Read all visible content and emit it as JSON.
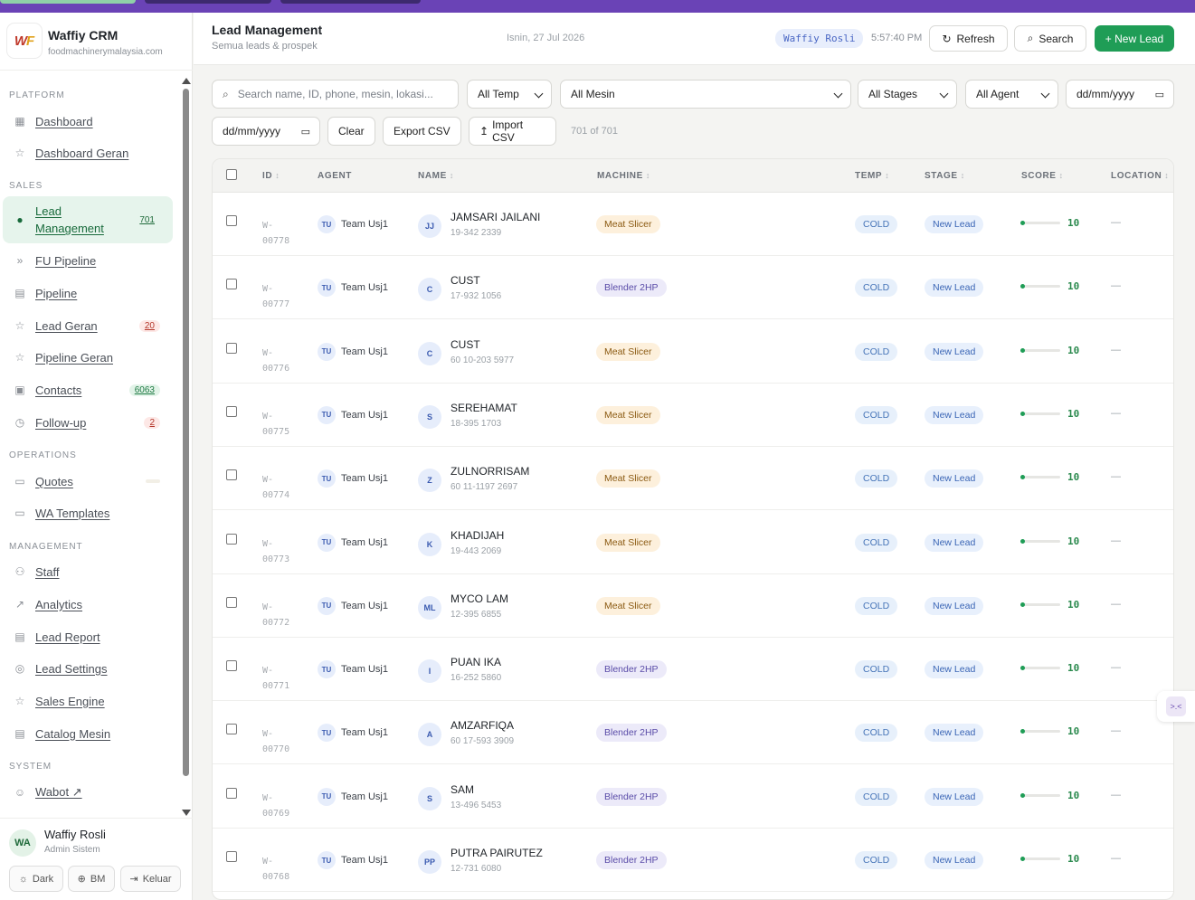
{
  "colors": {
    "accent": "#1f9d56",
    "top_strip": "#6a43b6",
    "active_nav_bg": "#e6f4ec"
  },
  "brand": {
    "logo_text_w": "W",
    "logo_text_f": "F",
    "title": "Waffiy CRM",
    "subtitle": "foodmachinerymalaysia.com"
  },
  "sidebar": {
    "sections": [
      {
        "label": "PLATFORM",
        "items": [
          {
            "label": "Dashboard",
            "icon": "grid-icon",
            "badge": ""
          },
          {
            "label": "Dashboard Geran",
            "icon": "star-icon",
            "badge": ""
          }
        ]
      },
      {
        "label": "SALES",
        "items": [
          {
            "label": "Lead Management",
            "icon": "person-icon",
            "badge": "701",
            "active": true
          },
          {
            "label": "FU Pipeline",
            "icon": "chevrons-icon",
            "badge": ""
          },
          {
            "label": "Pipeline",
            "icon": "table-icon",
            "badge": ""
          },
          {
            "label": "Lead Geran",
            "icon": "star-icon",
            "badge": "20"
          },
          {
            "label": "Pipeline Geran",
            "icon": "star-icon",
            "badge": ""
          },
          {
            "label": "Contacts",
            "icon": "contact-icon",
            "badge": "6063"
          },
          {
            "label": "Follow-up",
            "icon": "clock-icon",
            "badge": "2"
          }
        ]
      },
      {
        "label": "OPERATIONS",
        "items": [
          {
            "label": "Quotes",
            "icon": "doc-icon",
            "badge": ""
          },
          {
            "label": "WA Templates",
            "icon": "doc-icon",
            "badge": ""
          }
        ]
      },
      {
        "label": "MANAGEMENT",
        "items": [
          {
            "label": "Staff",
            "icon": "users-icon",
            "badge": ""
          },
          {
            "label": "Analytics",
            "icon": "trend-icon",
            "badge": ""
          },
          {
            "label": "Lead Report",
            "icon": "report-icon",
            "badge": ""
          },
          {
            "label": "Lead Settings",
            "icon": "settings-icon",
            "badge": ""
          },
          {
            "label": "Sales Engine",
            "icon": "star-icon",
            "badge": ""
          },
          {
            "label": "Catalog Mesin",
            "icon": "table-icon",
            "badge": ""
          }
        ]
      },
      {
        "label": "SYSTEM",
        "items": [
          {
            "label": "Wabot ↗",
            "icon": "bot-icon",
            "badge": ""
          }
        ]
      }
    ]
  },
  "user": {
    "initials": "WA",
    "name": "Waffiy Rosli",
    "role": "Admin Sistem",
    "dark_label": "Dark",
    "lang_label": "BM",
    "logout_label": "Keluar"
  },
  "header": {
    "title": "Lead Management",
    "subtitle": "Semua leads & prospek",
    "date": "Isnin, 27 Jul 2026",
    "user_chip": "Waffiy Rosli",
    "time": "5:57:40 PM",
    "refresh_label": "Refresh",
    "search_label": "Search",
    "new_lead_label": "+ New Lead"
  },
  "filters": {
    "search_placeholder": "Search name, ID, phone, mesin, lokasi...",
    "temp": "All Temp",
    "mesin": "All Mesin",
    "stages": "All Stages",
    "agent": "All Agent",
    "date_from": "dd/mm/yyyy",
    "date_to": "dd/mm/yyyy",
    "clear_label": "Clear",
    "export_label": "Export CSV",
    "import_label": "Import CSV",
    "count": "701 of 701"
  },
  "table": {
    "headers": {
      "id": "ID",
      "agent": "AGENT",
      "name": "NAME",
      "machine": "MACHINE",
      "temp": "TEMP",
      "stage": "STAGE",
      "score": "SCORE",
      "location": "LOCATION"
    },
    "rows": [
      {
        "id1": "W-",
        "id2": "00778",
        "agent_initials": "TU",
        "agent": "Team Usj1",
        "name_initials": "JJ",
        "name": "JAMSARI JAILANI",
        "phone": "19-342 2339",
        "machine": "Meat Slicer",
        "machine_type": "slicer",
        "temp": "COLD",
        "stage": "New Lead",
        "score": "10",
        "location": "—"
      },
      {
        "id1": "W-",
        "id2": "00777",
        "agent_initials": "TU",
        "agent": "Team Usj1",
        "name_initials": "C",
        "name": "CUST",
        "phone": "17-932 1056",
        "machine": "Blender 2HP",
        "machine_type": "blender",
        "temp": "COLD",
        "stage": "New Lead",
        "score": "10",
        "location": "—"
      },
      {
        "id1": "W-",
        "id2": "00776",
        "agent_initials": "TU",
        "agent": "Team Usj1",
        "name_initials": "C",
        "name": "CUST",
        "phone": "60 10-203 5977",
        "machine": "Meat Slicer",
        "machine_type": "slicer",
        "temp": "COLD",
        "stage": "New Lead",
        "score": "10",
        "location": "—"
      },
      {
        "id1": "W-",
        "id2": "00775",
        "agent_initials": "TU",
        "agent": "Team Usj1",
        "name_initials": "S",
        "name": "SEREHAMAT",
        "phone": "18-395 1703",
        "machine": "Meat Slicer",
        "machine_type": "slicer",
        "temp": "COLD",
        "stage": "New Lead",
        "score": "10",
        "location": "—"
      },
      {
        "id1": "W-",
        "id2": "00774",
        "agent_initials": "TU",
        "agent": "Team Usj1",
        "name_initials": "Z",
        "name": "ZULNORRISAM",
        "phone": "60 11-1197 2697",
        "machine": "Meat Slicer",
        "machine_type": "slicer",
        "temp": "COLD",
        "stage": "New Lead",
        "score": "10",
        "location": "—"
      },
      {
        "id1": "W-",
        "id2": "00773",
        "agent_initials": "TU",
        "agent": "Team Usj1",
        "name_initials": "K",
        "name": "KHADIJAH",
        "phone": "19-443 2069",
        "machine": "Meat Slicer",
        "machine_type": "slicer",
        "temp": "COLD",
        "stage": "New Lead",
        "score": "10",
        "location": "—"
      },
      {
        "id1": "W-",
        "id2": "00772",
        "agent_initials": "TU",
        "agent": "Team Usj1",
        "name_initials": "ML",
        "name": "MYCO LAM",
        "phone": "12-395 6855",
        "machine": "Meat Slicer",
        "machine_type": "slicer",
        "temp": "COLD",
        "stage": "New Lead",
        "score": "10",
        "location": "—"
      },
      {
        "id1": "W-",
        "id2": "00771",
        "agent_initials": "TU",
        "agent": "Team Usj1",
        "name_initials": "I",
        "name": "PUAN IKA",
        "phone": "16-252 5860",
        "machine": "Blender 2HP",
        "machine_type": "blender",
        "temp": "COLD",
        "stage": "New Lead",
        "score": "10",
        "location": "—"
      },
      {
        "id1": "W-",
        "id2": "00770",
        "agent_initials": "TU",
        "agent": "Team Usj1",
        "name_initials": "A",
        "name": "AMZARFIQA",
        "phone": "60 17-593 3909",
        "machine": "Blender 2HP",
        "machine_type": "blender",
        "temp": "COLD",
        "stage": "New Lead",
        "score": "10",
        "location": "—"
      },
      {
        "id1": "W-",
        "id2": "00769",
        "agent_initials": "TU",
        "agent": "Team Usj1",
        "name_initials": "S",
        "name": "SAM",
        "phone": "13-496 5453",
        "machine": "Blender 2HP",
        "machine_type": "blender",
        "temp": "COLD",
        "stage": "New Lead",
        "score": "10",
        "location": "—"
      },
      {
        "id1": "W-",
        "id2": "00768",
        "agent_initials": "TU",
        "agent": "Team Usj1",
        "name_initials": "PP",
        "name": "PUTRA PAIRUTEZ",
        "phone": "12-731 6080",
        "machine": "Blender 2HP",
        "machine_type": "blender",
        "temp": "COLD",
        "stage": "New Lead",
        "score": "10",
        "location": "—"
      }
    ]
  },
  "float_button": {
    "label": ">.<"
  }
}
